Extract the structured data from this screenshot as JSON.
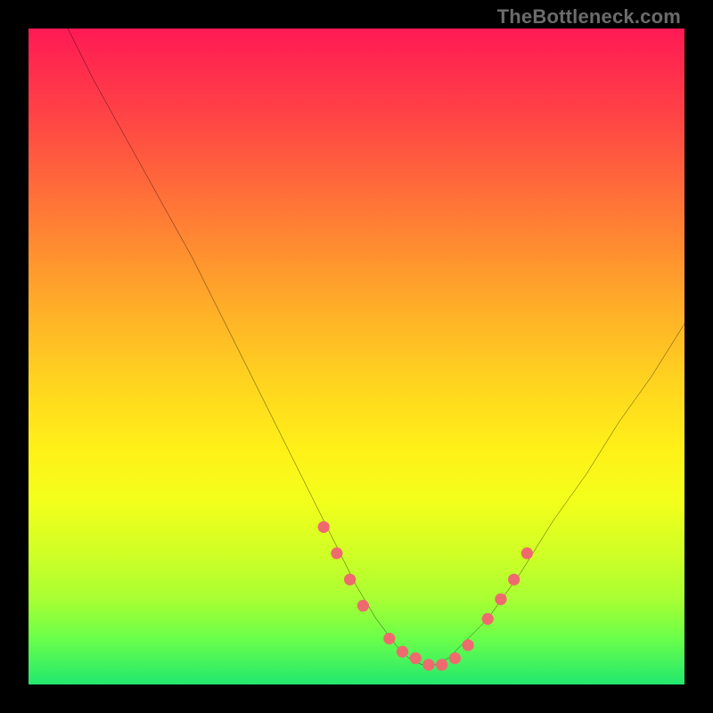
{
  "watermark": {
    "text": "TheBottleneck.com"
  },
  "chart_data": {
    "type": "line",
    "title": "",
    "xlabel": "",
    "ylabel": "",
    "xlim": [
      0,
      100
    ],
    "ylim": [
      0,
      100
    ],
    "series": [
      {
        "name": "bottleneck-curve",
        "x": [
          6,
          10,
          15,
          20,
          25,
          30,
          35,
          40,
          45,
          50,
          53,
          56,
          58,
          60,
          62,
          64,
          66,
          70,
          75,
          80,
          85,
          90,
          95,
          100
        ],
        "y": [
          100,
          92,
          83,
          74,
          65,
          55,
          45,
          35,
          25,
          15,
          10,
          6,
          4,
          3,
          3,
          4,
          6,
          10,
          17,
          25,
          32,
          40,
          47,
          55
        ]
      }
    ],
    "markers": {
      "name": "highlight-dots",
      "color": "#ef6a6f",
      "x": [
        45,
        47,
        49,
        51,
        55,
        57,
        59,
        61,
        63,
        65,
        67,
        70,
        72,
        74,
        76
      ],
      "y": [
        24,
        20,
        16,
        12,
        7,
        5,
        4,
        3,
        3,
        4,
        6,
        10,
        13,
        16,
        20
      ]
    }
  }
}
